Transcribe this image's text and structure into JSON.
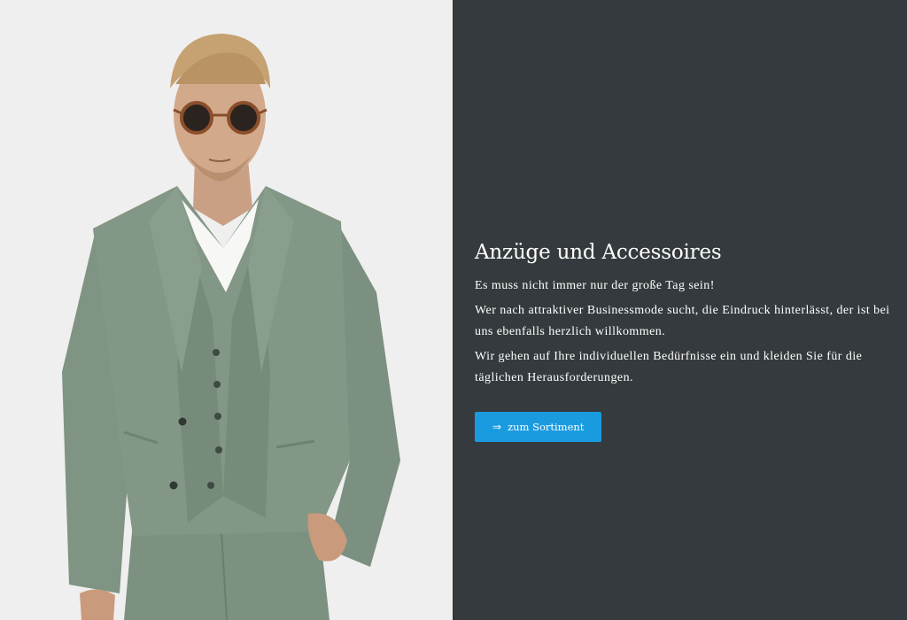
{
  "hero": {
    "image_alt": "Model im hellgrünen dreiteiligen Anzug mit Sonnenbrille"
  },
  "content": {
    "headline": "Anzüge und Accessoires",
    "paragraphs": [
      "Es muss nicht immer nur der große Tag sein!",
      "Wer nach attraktiver Businessmode sucht, die Eindruck hinterlässt, der ist bei uns ebenfalls herzlich willkommen.",
      "Wir gehen auf Ihre individuellen Bedürfnisse ein und kleiden Sie für die täglichen Herausforderungen."
    ],
    "cta_arrow": "⇒",
    "cta_label": "zum Sortiment"
  },
  "colors": {
    "panel_bg": "#343a3d",
    "button_bg": "#1a9be0",
    "suit": "#7f9482"
  }
}
